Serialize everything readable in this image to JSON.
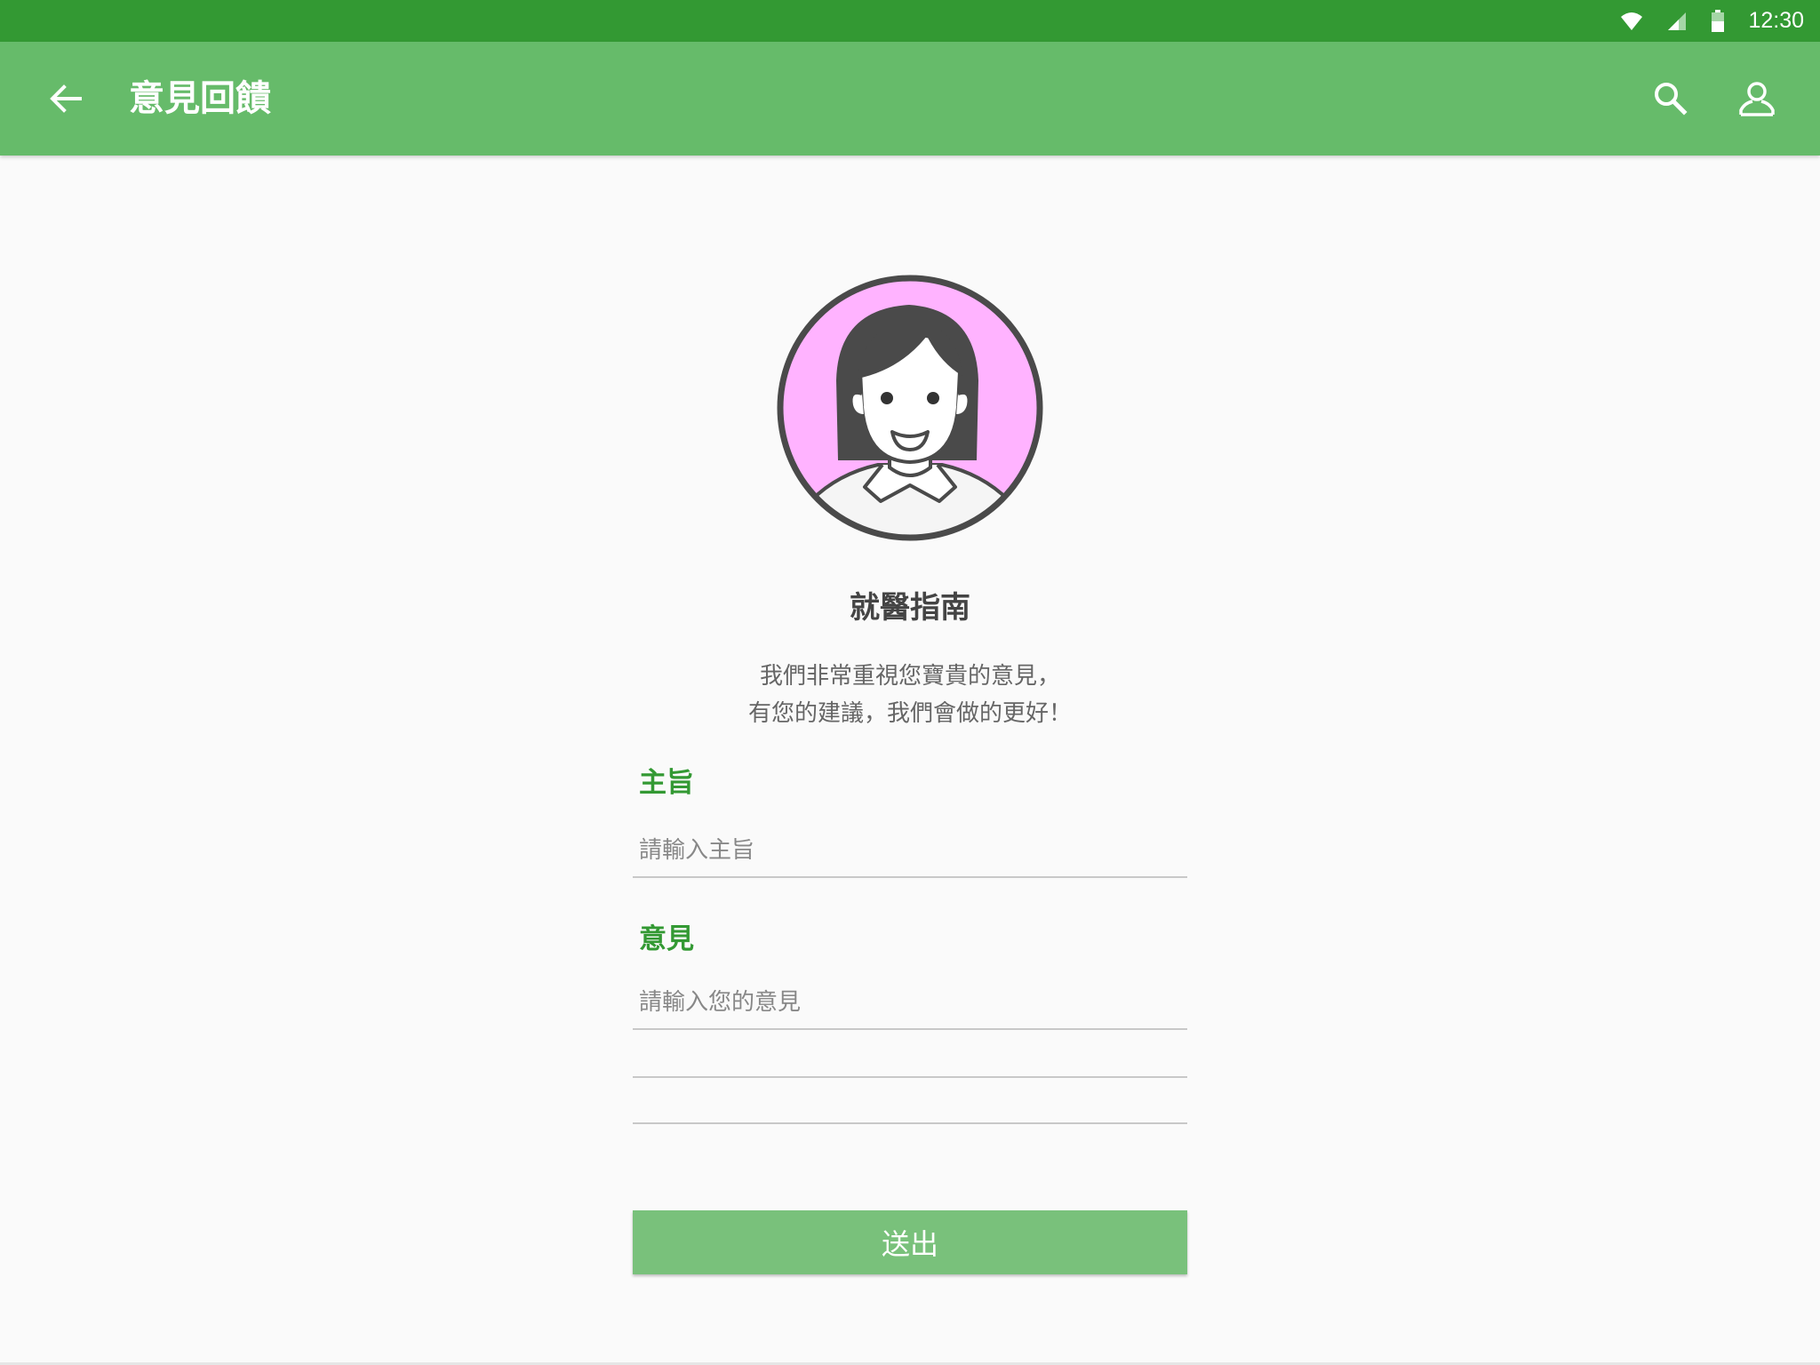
{
  "status_bar": {
    "time": "12:30",
    "icons": [
      "wifi-icon",
      "signal-icon",
      "battery-icon"
    ],
    "color": "#339933"
  },
  "app_bar": {
    "title": "意見回饋",
    "back_icon": "arrow-left-icon",
    "actions": [
      "search-icon",
      "account-icon"
    ],
    "color": "#66bb6a"
  },
  "avatar": {
    "icon": "doctor-avatar-icon",
    "background": "#ffb3ff"
  },
  "app_name": "就醫指南",
  "intro": {
    "line1": "我們非常重視您寶貴的意見，",
    "line2": "有您的建議，我們會做的更好！"
  },
  "form": {
    "subject": {
      "label": "主旨",
      "value": "",
      "placeholder": "請輸入主旨"
    },
    "feedback": {
      "label": "意見",
      "value": "",
      "placeholder": "請輸入您的意見"
    },
    "submit_label": "送出",
    "accent_color": "#339933",
    "button_color": "#79c17b"
  }
}
